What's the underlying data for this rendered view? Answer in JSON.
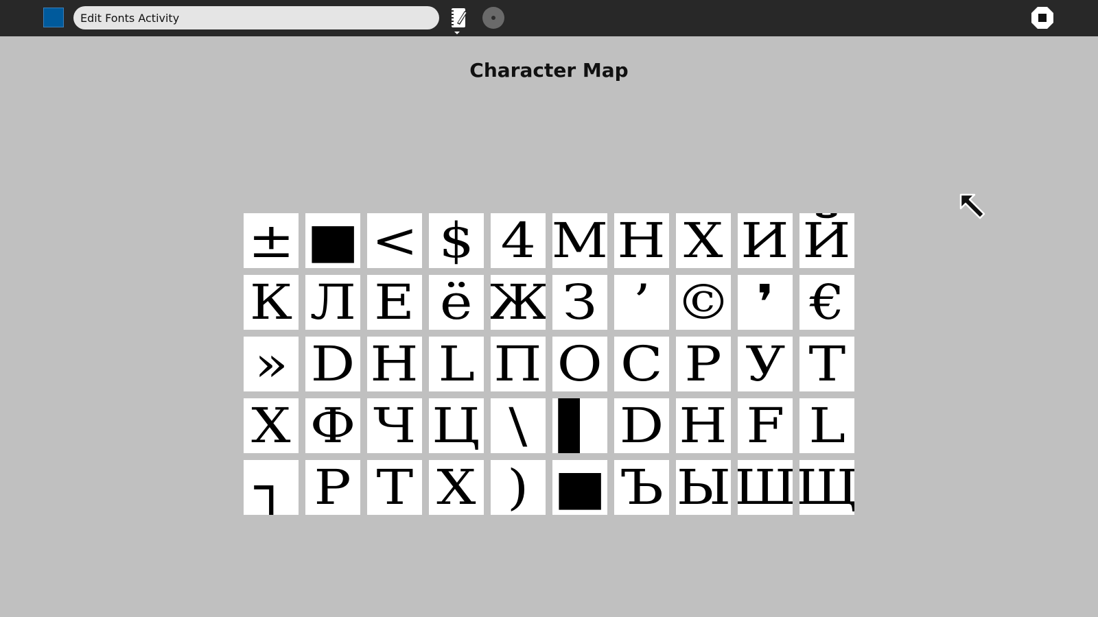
{
  "toolbar": {
    "activity_title": "Edit Fonts Activity",
    "activity_icon_color": "#005a9c",
    "journal_icon": "journal-icon",
    "share_icon": "share-icon",
    "stop_icon": "stop-icon"
  },
  "main": {
    "title": "Character Map",
    "glyphs": [
      "±",
      "■",
      "<",
      "$",
      "4",
      "M",
      "H",
      "X",
      "И",
      "Й",
      "К",
      "Л",
      "Е",
      "ё",
      "Ж",
      "З",
      "’",
      "©",
      "❜",
      "€",
      "»",
      "D",
      "H",
      "L",
      "П",
      "О",
      "С",
      "Р",
      "У",
      "Т",
      "Х",
      "Ф",
      "Ч",
      "Ц",
      "\\",
      "▌",
      "D",
      "H",
      "F",
      "L",
      "┐",
      "P",
      "T",
      "X",
      ")",
      "■",
      "Ъ",
      "Ы",
      "Ш",
      "Щ"
    ]
  },
  "colors": {
    "toolbar_bg": "#282828",
    "canvas_bg": "#c0c0c0",
    "cell_bg": "#ffffff"
  }
}
